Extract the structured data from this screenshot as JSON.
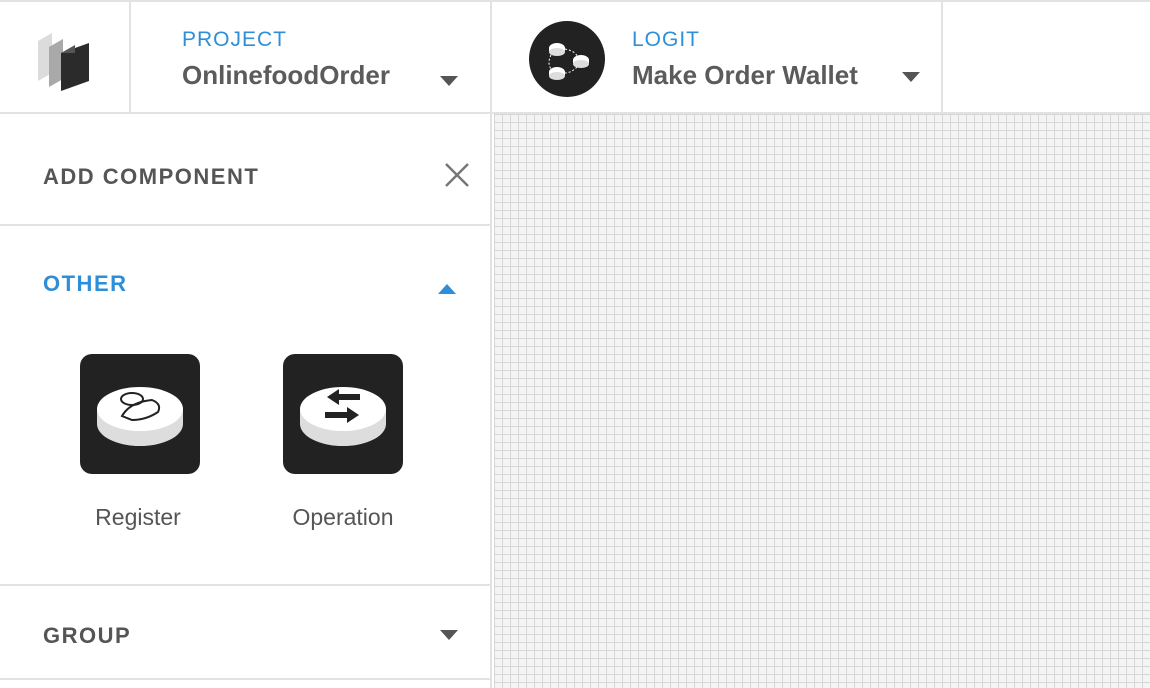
{
  "header": {
    "project": {
      "label": "PROJECT",
      "value": "OnlinefoodOrder"
    },
    "logit": {
      "label": "LOGIT",
      "value": "Make Order Wallet"
    }
  },
  "panel": {
    "title": "ADD COMPONENT",
    "sections": {
      "other": {
        "title": "OTHER",
        "components": [
          {
            "label": "Register",
            "icon": "register-coin-icon"
          },
          {
            "label": "Operation",
            "icon": "operation-coin-icon"
          }
        ]
      },
      "group": {
        "title": "GROUP"
      }
    }
  },
  "colors": {
    "accent": "#2e8fd8",
    "tile": "#222222",
    "text": "#555555"
  }
}
